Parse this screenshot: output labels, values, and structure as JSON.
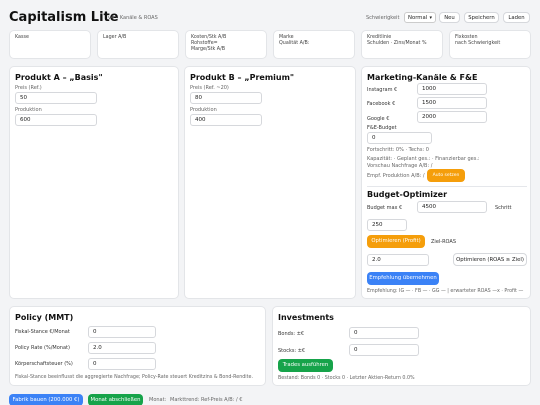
{
  "header": {
    "title": "Capitalism Lite",
    "subtitle": "v4 – Kanäle & ROAS",
    "difficulty_label": "Schwierigkeit",
    "difficulty_value": "Normal",
    "new_label": "Neu",
    "save_label": "Speichern",
    "load_label": "Laden"
  },
  "kpis": [
    {
      "lines": [
        "Kasse"
      ]
    },
    {
      "lines": [
        "Lager A/B"
      ]
    },
    {
      "lines": [
        "Kosten/Stk A/B",
        "Rohstoffe=",
        "Marge/Stk A/B"
      ]
    },
    {
      "lines": [
        "Marke",
        "Qualität A/B:"
      ]
    },
    {
      "lines": [
        "Kreditlinie",
        "Schulden · Zins/Monat %"
      ]
    },
    {
      "lines": [
        "Fixkosten",
        "nach Schwierigkeit"
      ]
    }
  ],
  "productA": {
    "title": "Produkt A – „Basis\"",
    "price_label": "Preis (Ref.)",
    "price_value": "50",
    "prod_label": "Produktion",
    "prod_value": "600"
  },
  "productB": {
    "title": "Produkt B – „Premium\"",
    "price_label": "Preis (Ref. ~20)",
    "price_value": "80",
    "prod_label": "Produktion",
    "prod_value": "400"
  },
  "marketing": {
    "title": "Marketing-Kanäle & F&E",
    "instagram_label": "Instagram €",
    "instagram_value": "1000",
    "facebook_label": "Facebook €",
    "facebook_value": "1500",
    "google_label": "Google €",
    "google_value": "2000",
    "rd_label": "F&E-Budget",
    "rd_value": "0",
    "progress_text": "Fortschritt: 0% · Techs: 0",
    "capacity_text": "Kapazität: · Geplant ges.: · Finanzierbar ges.:",
    "forecast_text": "Vorschau Nachfrage A/B: /",
    "recommended_text": "Empf. Produktion A/B: /",
    "auto_label": "Auto setzen"
  },
  "optimizer": {
    "title": "Budget-Optimizer",
    "budget_label": "Budget max €",
    "budget_value": "4500",
    "step_label": "Schritt",
    "step_value": "250",
    "optimize_profit_label": "Optimieren (Profit)",
    "target_roas_label": "Ziel-ROAS",
    "roas_value": "2.0",
    "optimize_roas_label": "Optimieren (ROAS ≥ Ziel)",
    "apply_label": "Empfehlung übernehmen",
    "recommendation_text": "Empfehlung: IG — · FB — · GG — | erwarteter ROAS —x · Profit —"
  },
  "policy": {
    "title": "Policy (MMT)",
    "fiscal_label": "Fiskal-Stance €/Monat",
    "fiscal_value": "0",
    "rate_label": "Policy Rate (%/Monat)",
    "rate_value": "2.0",
    "tax_label": "Körperschaftsteuer (%)",
    "tax_value": "0",
    "note": "Fiskal-Stance beeinflusst die aggregierte Nachfrage; Policy-Rate steuert Kreditzins & Bond-Rendite."
  },
  "investments": {
    "title": "Investments",
    "bonds_label": "Bonds: ±€",
    "bonds_value": "0",
    "stocks_label": "Stocks: ±€",
    "stocks_value": "0",
    "trade_label": "Trades ausführen",
    "holdings_text": "Bestand: Bonds 0 · Stocks 0 · Letzter Aktien-Return 0.0%"
  },
  "footer": {
    "build_label": "Fabrik bauen (200.000 €)",
    "month_label": "Monat abschließen",
    "month_text": "Monat:",
    "trend_text": "Markttrend:",
    "ref_text": "Ref-Preis A/B: / €"
  },
  "colors": {
    "orange": "#f59e0b",
    "blue": "#3b82f6",
    "green": "#16a34a"
  }
}
